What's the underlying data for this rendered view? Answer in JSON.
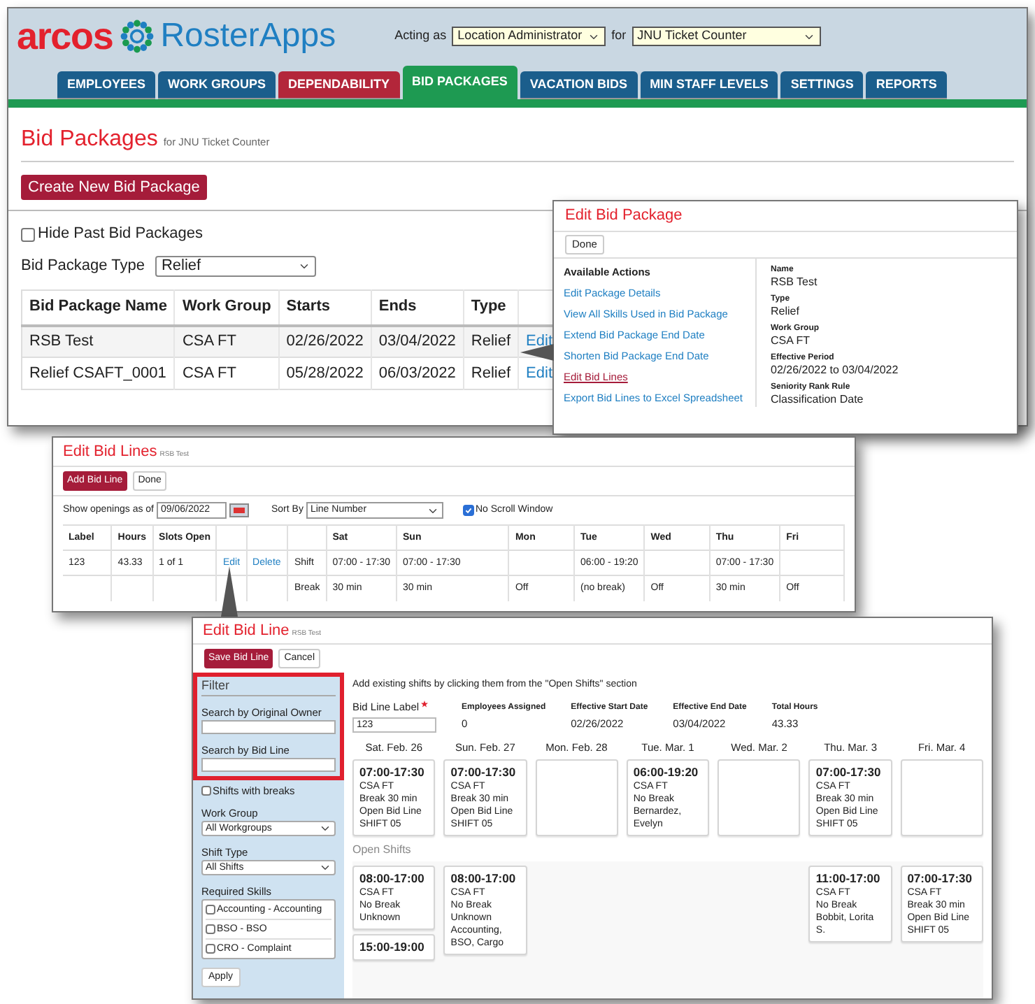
{
  "main_window": {
    "brand": "arcos",
    "product": "RosterApps",
    "acting_as_label": "Acting as",
    "role": "Location Administrator",
    "for_label": "for",
    "location": "JNU Ticket Counter",
    "tabs": [
      {
        "label": "EMPLOYEES",
        "selected": false,
        "color": "#1b5e8c"
      },
      {
        "label": "WORK GROUPS",
        "selected": false,
        "color": "#1b5e8c"
      },
      {
        "label": "DEPENDABILITY",
        "selected": false,
        "color": "#b3263a"
      },
      {
        "label": "BID PACKAGES",
        "selected": true,
        "color": "#1e9a52"
      },
      {
        "label": "VACATION BIDS",
        "selected": false,
        "color": "#1b5e8c"
      },
      {
        "label": "MIN STAFF LEVELS",
        "selected": false,
        "color": "#1b5e8c"
      },
      {
        "label": "SETTINGS",
        "selected": false,
        "color": "#1b5e8c"
      },
      {
        "label": "REPORTS",
        "selected": false,
        "color": "#1b5e8c"
      }
    ],
    "page_title": "Bid Packages",
    "page_subtitle": "for JNU Ticket Counter",
    "create_button": "Create New Bid Package",
    "hide_past": {
      "label": "Hide Past Bid Packages",
      "checked": false
    },
    "type_filter": {
      "label": "Bid Package Type",
      "value": "Relief"
    },
    "table": {
      "columns": [
        "Bid Package Name",
        "Work Group",
        "Starts",
        "Ends",
        "Type"
      ],
      "rows": [
        {
          "cells": [
            "RSB Test",
            "CSA FT",
            "02/26/2022",
            "03/04/2022",
            "Relief"
          ],
          "action": "Edit"
        },
        {
          "cells": [
            "Relief CSAFT_0001",
            "CSA FT",
            "05/28/2022",
            "06/03/2022",
            "Relief"
          ],
          "action": "Edit"
        }
      ]
    }
  },
  "edit_bid_package": {
    "title": "Edit Bid Package",
    "done_button": "Done",
    "actions_heading": "Available Actions",
    "actions": [
      {
        "label": "Edit Package Details",
        "selected": false
      },
      {
        "label": "View All Skills Used in Bid Package",
        "selected": false
      },
      {
        "label": "Extend Bid Package End Date",
        "selected": false
      },
      {
        "label": "Shorten Bid Package End Date",
        "selected": false
      },
      {
        "label": "Edit Bid Lines",
        "selected": true
      },
      {
        "label": "Export Bid Lines to Excel Spreadsheet",
        "selected": false
      }
    ],
    "details": [
      {
        "label": "Name",
        "value": "RSB Test"
      },
      {
        "label": "Type",
        "value": "Relief"
      },
      {
        "label": "Work Group",
        "value": "CSA FT"
      },
      {
        "label": "Effective Period",
        "value": "02/26/2022 to 03/04/2022"
      },
      {
        "label": "Seniority Rank Rule",
        "value": "Classification Date"
      }
    ]
  },
  "edit_bid_lines": {
    "title": "Edit Bid Lines",
    "subtitle": "RSB Test",
    "add_button": "Add Bid Line",
    "done_button": "Done",
    "openings_label": "Show openings as of",
    "openings_date": "09/06/2022",
    "sort_label": "Sort By",
    "sort_value": "Line Number",
    "no_scroll": {
      "label": "No Scroll Window",
      "checked": true
    },
    "columns": [
      "Label",
      "Hours",
      "Slots Open",
      "Sat",
      "Sun",
      "Mon",
      "Tue",
      "Wed",
      "Thu",
      "Fri"
    ],
    "row": {
      "label": "123",
      "hours": "43.33",
      "slots": "1 of 1",
      "edit": "Edit",
      "delete": "Delete",
      "shift_label": "Shift",
      "break_label": "Break",
      "days": [
        {
          "shift": "07:00 - 17:30",
          "break": "30 min"
        },
        {
          "shift": "07:00 - 17:30",
          "break": "30 min"
        },
        {
          "break": "Off"
        },
        {
          "shift": "06:00 - 19:20",
          "break": "(no break)"
        },
        {
          "break": "Off"
        },
        {
          "shift": "07:00 - 17:30",
          "break": "30 min"
        },
        {
          "break": "Off"
        }
      ]
    }
  },
  "edit_bid_line": {
    "title": "Edit Bid Line",
    "subtitle": "RSB Test",
    "save_button": "Save Bid Line",
    "cancel_button": "Cancel",
    "filter": {
      "title": "Filter",
      "search_highlighted": true,
      "original_owner_label": "Search by Original Owner",
      "bid_line_search_label": "Search by Bid Line",
      "shifts_with_breaks": {
        "label": "Shifts with breaks",
        "checked": false
      },
      "work_group_label": "Work Group",
      "work_group_value": "All Workgroups",
      "shift_type_label": "Shift Type",
      "shift_type_value": "All Shifts",
      "skills_label": "Required Skills",
      "skills": [
        {
          "label": "Accounting - Accounting",
          "checked": false
        },
        {
          "label": "BSO - BSO",
          "checked": false
        },
        {
          "label": "CRO - Complaint",
          "checked": false
        }
      ],
      "apply_button": "Apply"
    },
    "instructions": "Add existing shifts by clicking them from the \"Open Shifts\" section",
    "fields": [
      {
        "label": "Bid Line Label",
        "kind": "input",
        "required": true,
        "value": "123"
      },
      {
        "label": "Employees Assigned",
        "kind": "text",
        "value": "0"
      },
      {
        "label": "Effective Start Date",
        "kind": "text",
        "value": "02/26/2022"
      },
      {
        "label": "Effective End Date",
        "kind": "text",
        "value": "03/04/2022"
      },
      {
        "label": "Total Hours",
        "kind": "text",
        "value": "43.33"
      }
    ],
    "open_shifts_heading": "Open Shifts",
    "days": [
      {
        "header": "Sat. Feb. 26",
        "shift": {
          "time": "07:00-17:30",
          "lines": [
            "CSA FT",
            "Break 30 min",
            "Open Bid Line",
            "SHIFT 05"
          ]
        },
        "open_shifts": [
          {
            "time": "08:00-17:00",
            "lines": [
              "CSA FT",
              "No Break",
              "Unknown"
            ]
          },
          {
            "time": "15:00-19:00"
          }
        ]
      },
      {
        "header": "Sun. Feb. 27",
        "shift": {
          "time": "07:00-17:30",
          "lines": [
            "CSA FT",
            "Break 30 min",
            "Open Bid Line",
            "SHIFT 05"
          ]
        },
        "open_shifts": [
          {
            "time": "08:00-17:00",
            "lines": [
              "CSA FT",
              "No Break",
              "Unknown",
              "Accounting, BSO, Cargo"
            ]
          }
        ]
      },
      {
        "header": "Mon. Feb. 28"
      },
      {
        "header": "Tue. Mar. 1",
        "shift": {
          "time": "06:00-19:20",
          "lines": [
            "CSA FT",
            "No Break",
            "Bernardez, Evelyn"
          ]
        }
      },
      {
        "header": "Wed. Mar. 2"
      },
      {
        "header": "Thu. Mar. 3",
        "shift": {
          "time": "07:00-17:30",
          "lines": [
            "CSA FT",
            "Break 30 min",
            "Open Bid Line",
            "SHIFT 05"
          ]
        },
        "open_shifts": [
          {
            "time": "11:00-17:00",
            "lines": [
              "CSA FT",
              "No Break",
              "Bobbit, Lorita S."
            ]
          }
        ]
      },
      {
        "header": "Fri. Mar. 4",
        "open_shifts": [
          {
            "time": "07:00-17:30",
            "lines": [
              "CSA FT",
              "Break 30 min",
              "Open Bid Line",
              "SHIFT 05"
            ]
          }
        ]
      }
    ]
  }
}
